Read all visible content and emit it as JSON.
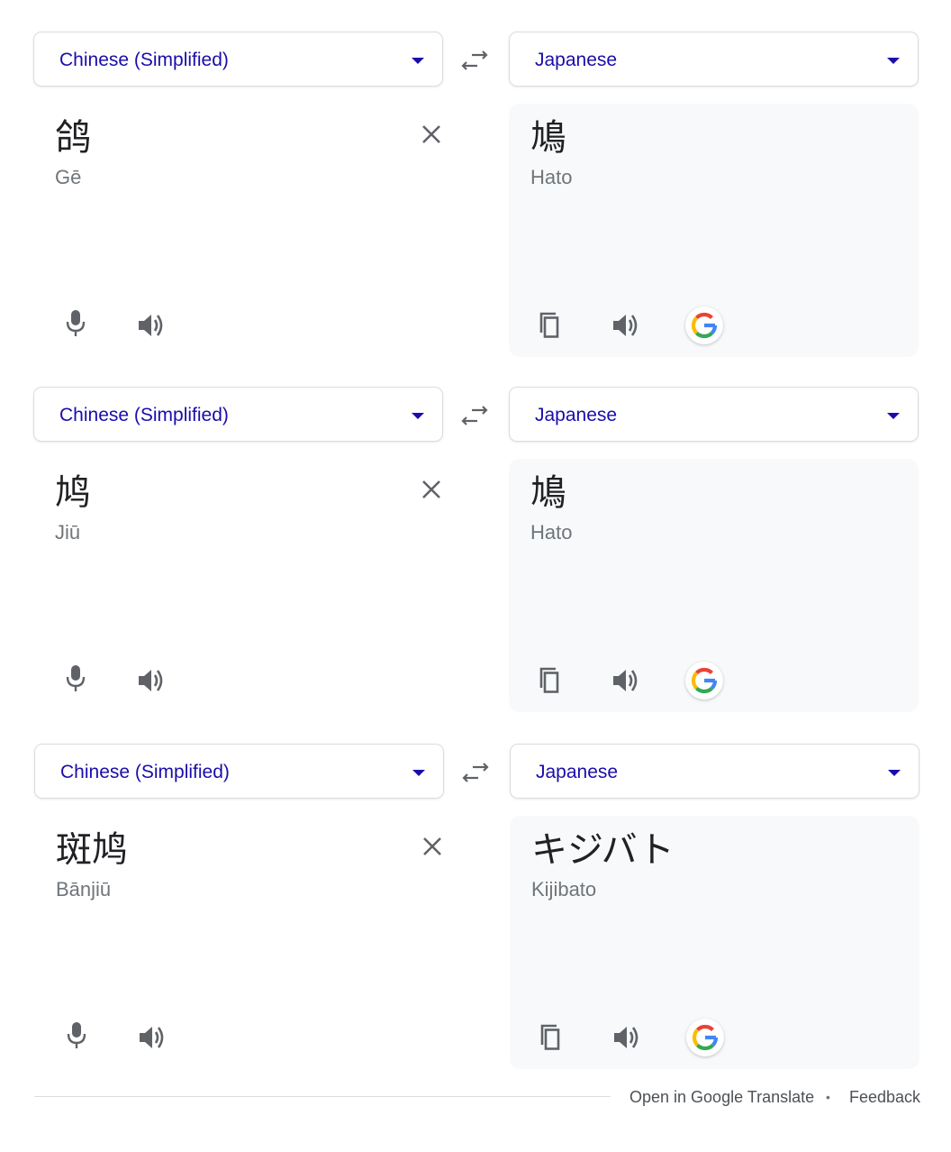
{
  "widgets": [
    {
      "source_language": "Chinese (Simplified)",
      "target_language": "Japanese",
      "source_text": "鸽",
      "source_romanization": "Gē",
      "translated_text": "鳩",
      "translated_romanization": "Hato"
    },
    {
      "source_language": "Chinese (Simplified)",
      "target_language": "Japanese",
      "source_text": "鸠",
      "source_romanization": "Jiū",
      "translated_text": "鳩",
      "translated_romanization": "Hato"
    },
    {
      "source_language": "Chinese (Simplified)",
      "target_language": "Japanese",
      "source_text": "斑鸠",
      "source_romanization": "Bānjiū",
      "translated_text": "キジバト",
      "translated_romanization": "Kijibato"
    }
  ],
  "footer": {
    "open_link": "Open in Google Translate",
    "separator": "•",
    "feedback_link": "Feedback"
  },
  "colors": {
    "link_blue": "#1a0dab",
    "icon_gray": "#5f6368",
    "text_gray": "#70757a",
    "panel_bg": "#f8f9fa",
    "border": "#dadce0"
  },
  "icons": {
    "swap": "swap-arrows-icon",
    "clear": "close-icon",
    "mic": "microphone-icon",
    "speaker": "speaker-icon",
    "copy": "copy-icon",
    "google": "google-g-logo"
  }
}
